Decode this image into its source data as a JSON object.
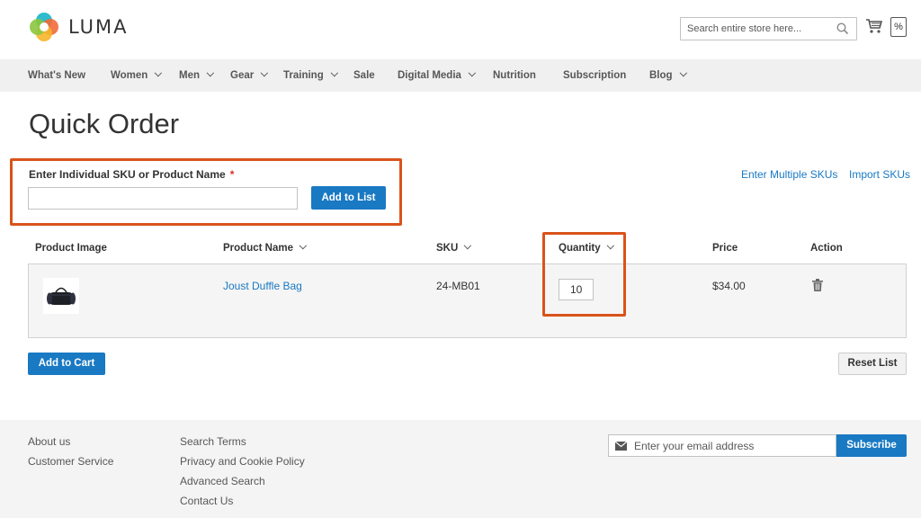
{
  "header": {
    "logo_text": "LUMA",
    "search_placeholder": "Search entire store here...",
    "compare_glyph": "%"
  },
  "nav": {
    "items": [
      {
        "label": "What's New",
        "has_dropdown": false
      },
      {
        "label": "Women",
        "has_dropdown": true
      },
      {
        "label": "Men",
        "has_dropdown": true
      },
      {
        "label": "Gear",
        "has_dropdown": true
      },
      {
        "label": "Training",
        "has_dropdown": true
      },
      {
        "label": "Sale",
        "has_dropdown": false
      },
      {
        "label": "Digital Media",
        "has_dropdown": true
      },
      {
        "label": "Nutrition",
        "has_dropdown": false
      },
      {
        "label": "Subscription",
        "has_dropdown": false
      },
      {
        "label": "Blog",
        "has_dropdown": true
      }
    ]
  },
  "page": {
    "title": "Quick Order"
  },
  "sku_form": {
    "label": "Enter Individual SKU or Product Name",
    "required_mark": "*",
    "input_value": "",
    "add_button": "Add to List",
    "enter_multiple_link": "Enter Multiple SKUs",
    "import_link": "Import SKUs"
  },
  "table": {
    "headers": {
      "image": "Product Image",
      "name": "Product Name",
      "sku": "SKU",
      "quantity": "Quantity",
      "price": "Price",
      "action": "Action"
    },
    "rows": [
      {
        "name": "Joust Duffle Bag",
        "sku": "24-MB01",
        "quantity": "10",
        "price": "$34.00"
      }
    ]
  },
  "actions": {
    "add_to_cart": "Add to Cart",
    "reset_list": "Reset List"
  },
  "footer": {
    "col1": [
      "About us",
      "Customer Service"
    ],
    "col2": [
      "Search Terms",
      "Privacy and Cookie Policy",
      "Advanced Search",
      "Contact Us"
    ],
    "newsletter_placeholder": "Enter your email address",
    "subscribe_button": "Subscribe"
  },
  "colors": {
    "accent": "#1979c3",
    "highlight": "#d9531a",
    "nav_bg": "#f0f0f0",
    "footer_bg": "#f4f4f4"
  }
}
